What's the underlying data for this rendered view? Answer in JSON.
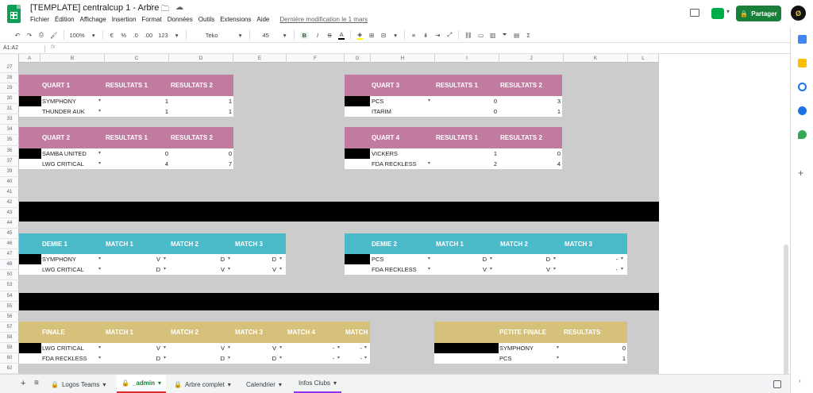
{
  "app": {
    "title": "[TEMPLATE] centralcup 1 - Arbre",
    "last_edit": "Dernière modification le 1 mars",
    "share_label": "Partager",
    "avatar_text": "Ø"
  },
  "menu": [
    "Fichier",
    "Édition",
    "Affichage",
    "Insertion",
    "Format",
    "Données",
    "Outils",
    "Extensions",
    "Aide"
  ],
  "toolbar": {
    "zoom": "100%",
    "currency": "€",
    "percent": "%",
    "dec_less": ".0",
    "dec_more": ".00",
    "number_format": "123",
    "font": "Teko",
    "font_size": "45"
  },
  "formula": {
    "namebox": "A1:A2",
    "fx": "fx"
  },
  "columns": [
    "A",
    "B",
    "C",
    "D",
    "E",
    "F",
    "G",
    "H",
    "I",
    "J",
    "K",
    "L"
  ],
  "rows": [
    "27",
    "28",
    "29",
    "30",
    "31",
    "33",
    "34",
    "35",
    "36",
    "37",
    "39",
    "40",
    "41",
    "42",
    "43",
    "44",
    "45",
    "46",
    "47",
    "48",
    "50",
    "53",
    "54",
    "55",
    "56",
    "57",
    "58",
    "59",
    "60",
    "62"
  ],
  "tables": {
    "quart1": {
      "headers": [
        "QUART 1",
        "RESULTATS 1",
        "RESULTATS 2"
      ],
      "rows": [
        {
          "team": "SYMPHONY",
          "v1": "1",
          "v2": "1"
        },
        {
          "team": "THUNDER AUK",
          "v1": "1",
          "v2": "1"
        }
      ]
    },
    "quart2": {
      "headers": [
        "QUART 2",
        "RESULTATS 1",
        "RESULTATS 2"
      ],
      "rows": [
        {
          "team": "SAMBA UNITED",
          "v1": "0",
          "v2": "0"
        },
        {
          "team": "LWG CRITICAL",
          "v1": "4",
          "v2": "7"
        }
      ]
    },
    "quart3": {
      "headers": [
        "QUART 3",
        "RESULTATS 1",
        "RESULTATS 2"
      ],
      "rows": [
        {
          "team": "PCS",
          "v1": "0",
          "v2": "3"
        },
        {
          "team": "ITARIM",
          "v1": "0",
          "v2": "1"
        }
      ]
    },
    "quart4": {
      "headers": [
        "QUART 4",
        "RESULTATS 1",
        "RESULTATS 2"
      ],
      "rows": [
        {
          "team": "VICKERS",
          "v1": "1",
          "v2": "0"
        },
        {
          "team": "FDA RECKLESS",
          "v1": "2",
          "v2": "4"
        }
      ]
    },
    "demie1": {
      "headers": [
        "DEMIE 1",
        "MATCH 1",
        "MATCH 2",
        "MATCH 3"
      ],
      "rows": [
        {
          "team": "SYMPHONY",
          "m1": "V",
          "m2": "D",
          "m3": "D"
        },
        {
          "team": "LWG CRITICAL",
          "m1": "D",
          "m2": "V",
          "m3": "V"
        }
      ]
    },
    "demie2": {
      "headers": [
        "DEMIE 2",
        "MATCH 1",
        "MATCH 2",
        "MATCH 3"
      ],
      "rows": [
        {
          "team": "PCS",
          "m1": "D",
          "m2": "D",
          "m3": "-"
        },
        {
          "team": "FDA RECKLESS",
          "m1": "V",
          "m2": "V",
          "m3": "-"
        }
      ]
    },
    "finale": {
      "headers": [
        "FINALE",
        "MATCH 1",
        "MATCH 2",
        "MATCH 3",
        "MATCH 4",
        "MATCH"
      ],
      "rows": [
        {
          "team": "LWG CRITICAL",
          "m1": "V",
          "m2": "V",
          "m3": "V",
          "m4": "-",
          "m5": "-"
        },
        {
          "team": "FDA RECKLESS",
          "m1": "D",
          "m2": "D",
          "m3": "D",
          "m4": "-",
          "m5": "-"
        }
      ]
    },
    "petite": {
      "headers": [
        "PETITE FINALE",
        "RESULTATS"
      ],
      "rows": [
        {
          "team": "SYMPHONY",
          "v1": "0"
        },
        {
          "team": "PCS",
          "v1": "1"
        }
      ]
    }
  },
  "sheet_tabs": [
    {
      "label": "Logos Teams"
    },
    {
      "label": "_admin"
    },
    {
      "label": "Arbre complet"
    },
    {
      "label": "Calendrier"
    },
    {
      "label": "Infos Clubs"
    }
  ],
  "colors": {
    "quart": "#c27ba0",
    "demie": "#4ab9c8",
    "finale": "#d6c17b",
    "share": "#188038"
  }
}
